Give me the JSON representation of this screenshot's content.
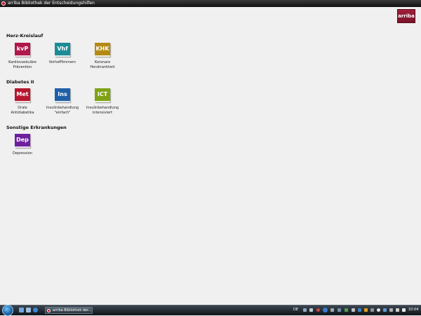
{
  "window": {
    "title": "arriba Bibliothek der Entscheidungshilfen"
  },
  "logo": {
    "text": "arriba"
  },
  "sections": [
    {
      "title": "Herz-Kreislauf"
    },
    {
      "title": "Diabetes II"
    },
    {
      "title": "Sonstige Erkrankungen"
    }
  ],
  "tiles": [
    {
      "abbr": "kvP",
      "label": "Kardiovaskuläre\nPrävention",
      "color": "#b0174a"
    },
    {
      "abbr": "Vhf",
      "label": "Vorhofflimmern",
      "color": "#1b8c96"
    },
    {
      "abbr": "KHK",
      "label": "Koronare\nHerzkrankheit",
      "color": "#b58a14"
    },
    {
      "abbr": "Met",
      "label": "Orale\nAntidiabetika",
      "color": "#b6162e"
    },
    {
      "abbr": "Ins",
      "label": "Insulinbehandlung\n\"einfach\"",
      "color": "#1f5fa8"
    },
    {
      "abbr": "ICT",
      "label": "Insulinbehandlung\nintensiviert",
      "color": "#7fa214"
    },
    {
      "abbr": "Dep",
      "label": "Depression",
      "color": "#6e1fa0"
    }
  ],
  "taskbar": {
    "task_label": "arriba Bibliothek der...",
    "language": "DE",
    "clock": "10:04"
  }
}
